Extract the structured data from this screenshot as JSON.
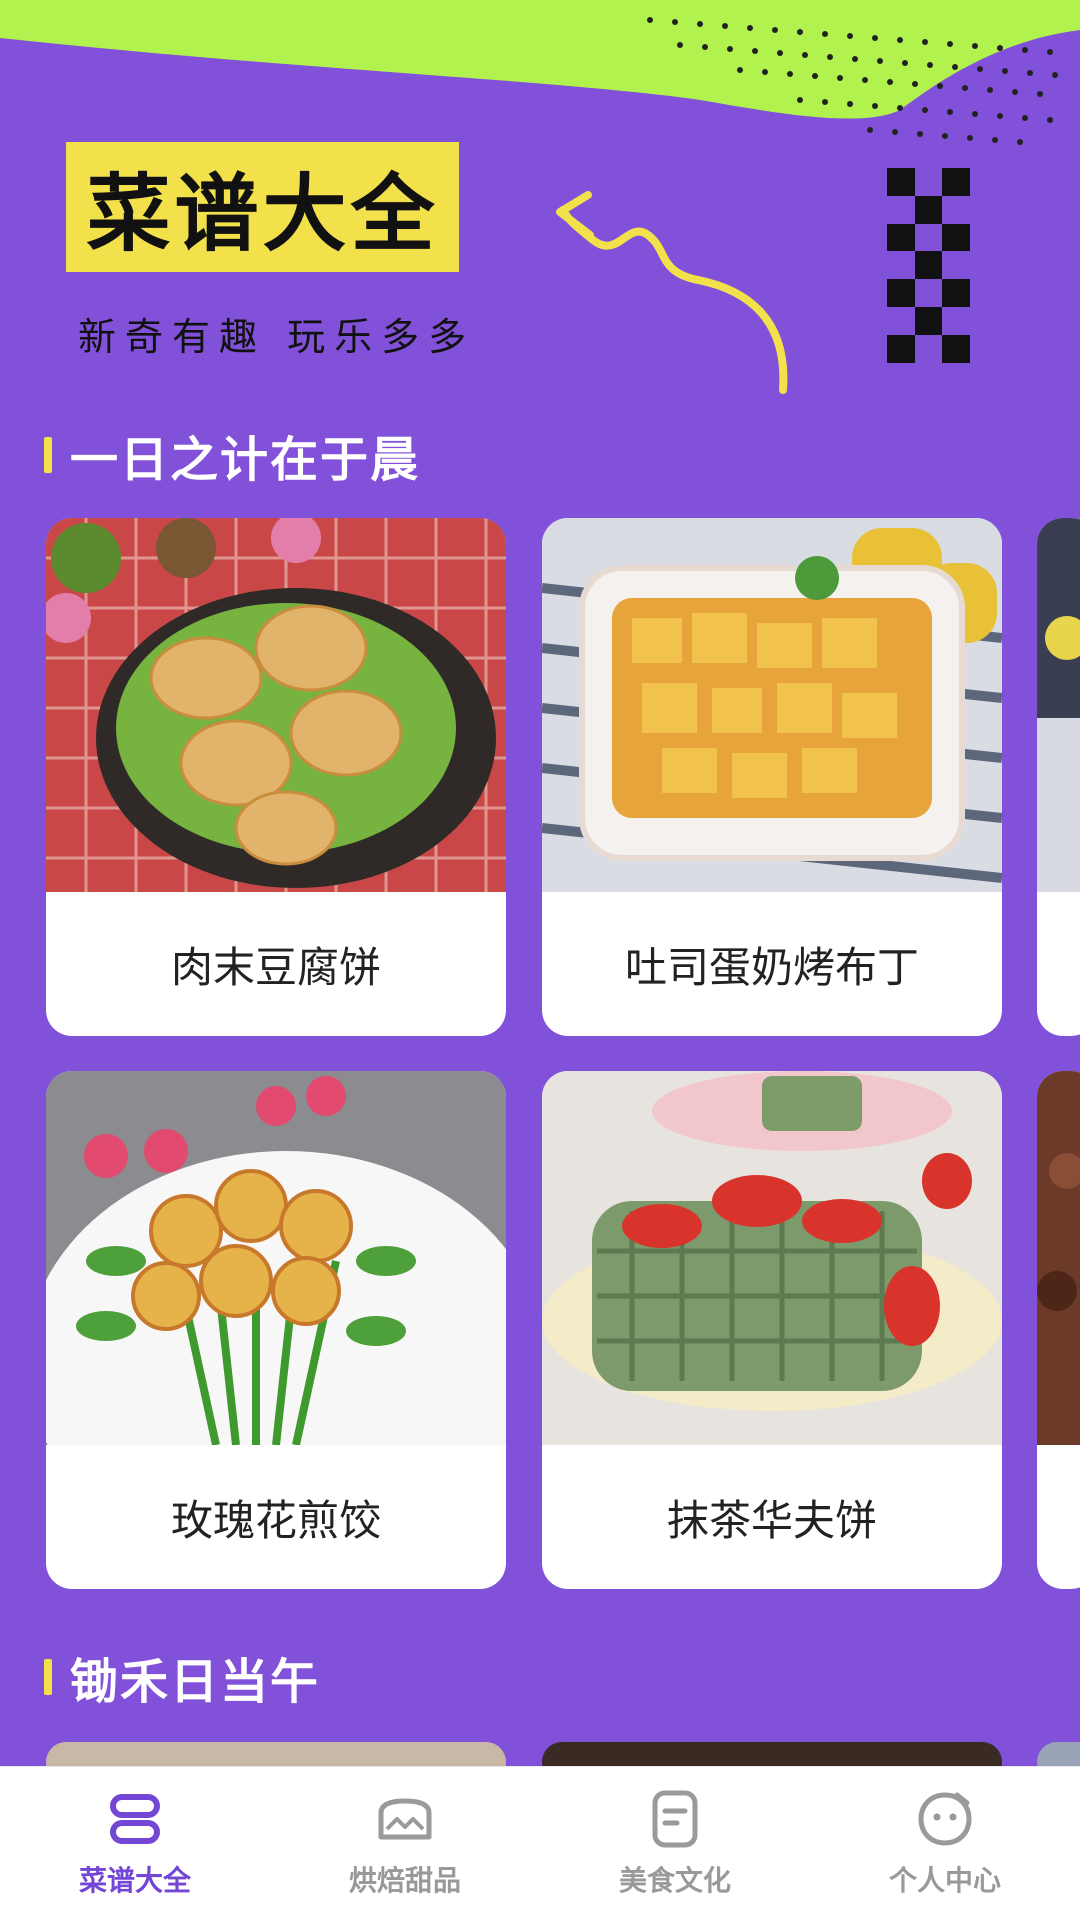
{
  "header": {
    "logo_text": "菜谱大全",
    "tagline": "新奇有趣 玩乐多多",
    "colors": {
      "background": "#8151D9",
      "accent": "#F3E14B",
      "band": "#B2F24E"
    }
  },
  "sections": [
    {
      "title": "一日之计在于晨",
      "cards": [
        {
          "name": "肉末豆腐饼",
          "photo": "tofu-patties-in-skillet"
        },
        {
          "name": "吐司蛋奶烤布丁",
          "photo": "toast-pudding-in-baking-dish"
        },
        {
          "name": "玫瑰花煎饺",
          "photo": "rose-shaped-dumplings"
        },
        {
          "name": "抹茶华夫饼",
          "photo": "matcha-waffle-with-strawberries"
        }
      ]
    },
    {
      "title": "锄禾日当午"
    }
  ],
  "tabs": [
    {
      "label": "菜谱大全",
      "icon": "recipes-icon",
      "active": true
    },
    {
      "label": "烘焙甜品",
      "icon": "bakery-icon",
      "active": false
    },
    {
      "label": "美食文化",
      "icon": "document-icon",
      "active": false
    },
    {
      "label": "个人中心",
      "icon": "profile-face-icon",
      "active": false
    }
  ]
}
